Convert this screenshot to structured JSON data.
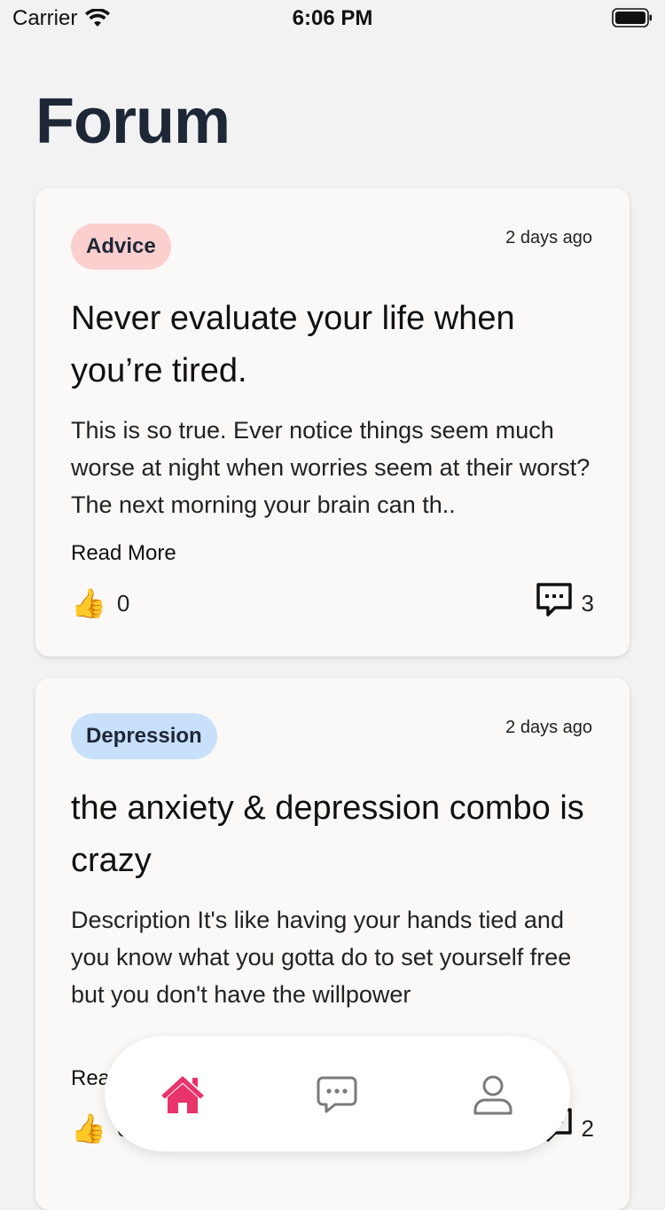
{
  "status_bar": {
    "carrier": "Carrier",
    "time": "6:06 PM"
  },
  "page_title": "Forum",
  "posts": [
    {
      "tag": "Advice",
      "tag_color": "#fccfcf",
      "time_ago": "2 days ago",
      "title": "Never evaluate your life when you’re tired.",
      "body": "This is so true. Ever notice things seem much worse at night when worries seem at their worst? The next morning your brain can th..",
      "read_more": "Read More",
      "likes": "0",
      "comments": "3"
    },
    {
      "tag": "Depression",
      "tag_color": "#c9e0fb",
      "time_ago": "2 days ago",
      "title": "the anxiety & depression combo is crazy",
      "body": "Description It's like having your hands tied and you know what you gotta do to set yourself free but you don't have the willpower",
      "read_more": "Read More",
      "likes": "0",
      "comments": "2"
    }
  ],
  "nav": {
    "active_color": "#e8336b",
    "inactive_color": "#7a7a7a",
    "items": [
      "home-icon",
      "chat-icon",
      "profile-icon"
    ]
  }
}
